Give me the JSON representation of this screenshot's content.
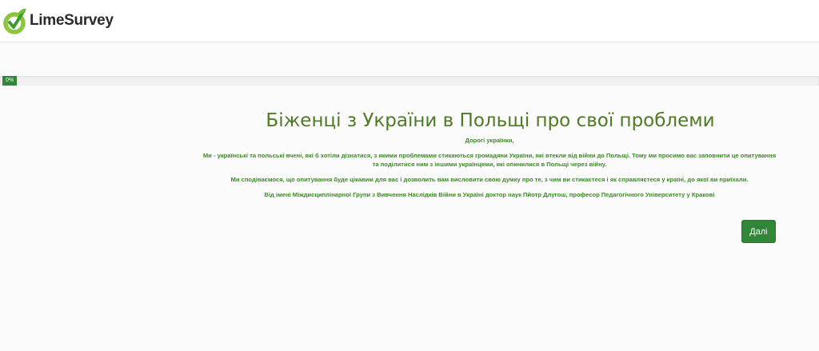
{
  "header": {
    "brand_name": "LimeSurvey",
    "logo_icon": "limesurvey-logo-icon",
    "brand_color": "#8cc63f"
  },
  "progress": {
    "percent": 0,
    "label": "0%",
    "color": "#328637"
  },
  "survey": {
    "title": "Біженці з України в Польщі про свої проблеми",
    "welcome": {
      "greeting": "Дорогі українки,",
      "paragraph1": "Ми - українські та польські вчені, які б хотіли дізнатися, з якими проблемами стикаються громадяни України, які втекли від війни до Польщі. Тому ми просимо вас заповнити це опитування та поділитися ним з іншими українцями, які опинилися в Польщі через війну.",
      "paragraph2": "Ми сподіваємося, що опитування буде цікавим для вас і дозволить вам висловити свою думку про те, з чим ви стикаєтеся і як справляєтеся у країні, до якої ви приїхали.",
      "signature": "Від імені Міждисциплінарної Групи з Вивчення Наслідків Війни в Україні доктор наук Пйотр Длугош, професор Педагогічного Університету у Кракові"
    },
    "text_color": "#3c8a26",
    "title_color": "#4e7a24"
  },
  "navigation": {
    "next_label": "Далі",
    "button_color": "#328637"
  }
}
